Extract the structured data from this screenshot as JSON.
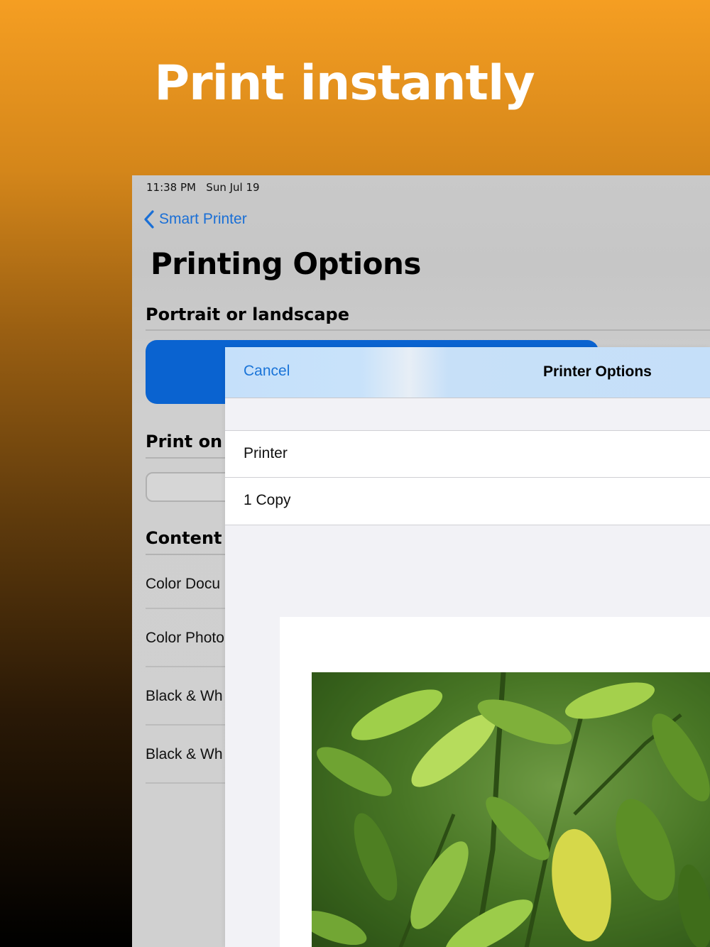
{
  "banner": {
    "headline": "Print instantly"
  },
  "status_bar": {
    "time": "11:38 PM",
    "date": "Sun Jul 19"
  },
  "nav": {
    "back_label": "Smart Printer"
  },
  "page": {
    "title": "Printing Options",
    "sections": {
      "orientation": "Portrait or landscape",
      "print_on": "Print on d",
      "content": "Content g"
    },
    "content_items": [
      "Color Docu",
      "Color Photo",
      "Black & Wh",
      "Black & Wh"
    ]
  },
  "sheet": {
    "cancel_label": "Cancel",
    "title": "Printer Options",
    "rows": [
      "Printer",
      "1 Copy"
    ]
  },
  "colors": {
    "accent_blue": "#0a63d0",
    "link_blue": "#1a74d8",
    "banner_orange": "#f59e22"
  },
  "icons": {
    "back": "chevron-left-icon"
  }
}
